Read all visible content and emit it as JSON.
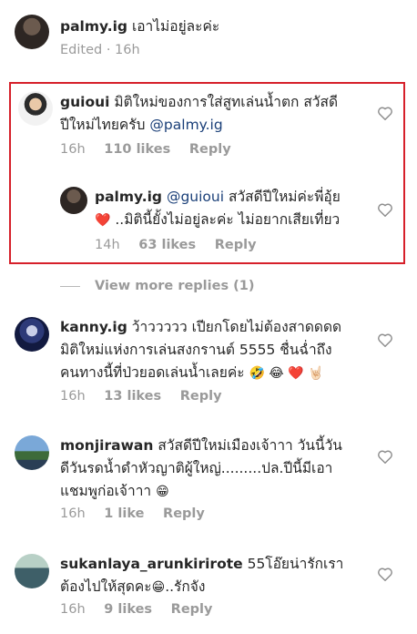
{
  "comments": {
    "c0": {
      "user": "palmy.ig",
      "text": "เอาไม่อยู่ละค่ะ",
      "time": "Edited · 16h"
    },
    "c1": {
      "user": "guioui",
      "line1": "มิติใหม่ของการใส่สูทเล่นน้ำตก สวัสดี",
      "line2": "ปีใหม่ไทยครับ",
      "mention": "@palmy.ig",
      "time": "16h",
      "likes": "110 likes",
      "reply": "Reply"
    },
    "c2": {
      "user": "palmy.ig",
      "mention": "@guioui",
      "line1": "สวัสดีปีใหม่ค่ะพี่อุ้ย",
      "heart_emoji": "❤️",
      "line2": "..มิตินี้ยั้งไม่อยู่ละค่ะ ไม่อยากเสียเที่ยว",
      "time": "14h",
      "likes": "63 likes",
      "reply": "Reply"
    },
    "view_more": "View more replies (1)",
    "c3": {
      "user": "kanny.ig",
      "line1": "ว้าววววว เปียกโดยไม่ต้องสาดดดด",
      "line2": "มิติใหม่แห่งการเล่นสงกรานต์ 5555 ชื่นฉ่ำถึง",
      "line3": "คนทางนี้ที่ป่วยอดเล่นน้ำเลยค่ะ",
      "emojis": "🤣 😂 ❤️ 🤘🏻",
      "time": "16h",
      "likes": "13 likes",
      "reply": "Reply"
    },
    "c4": {
      "user": "monjirawan",
      "line1": "สวัสดีปีใหม่เมืองเจ้าาา วันนี้วัน",
      "line2": "ดีวันรดน้ำดำหัวญาติผู้ใหญ่.........ปล.ปีนี้มีเอา",
      "line3": "แชมพูก่อเจ้าาา",
      "emojis": "😁",
      "time": "16h",
      "likes": "1 like",
      "reply": "Reply"
    },
    "c5": {
      "user": "sukanlaya_arunkirirote",
      "line1": "55โอ๊ยน่ารักเรา",
      "line2": "ต้องไปให้สุดคะ",
      "emoji": "😁",
      "line2b": "..รักจัง",
      "time": "16h",
      "likes": "9 likes",
      "reply": "Reply"
    }
  },
  "colors": {
    "highlight": "#d6202a",
    "muted": "#9a9a9a",
    "mention": "#1a3f78"
  }
}
